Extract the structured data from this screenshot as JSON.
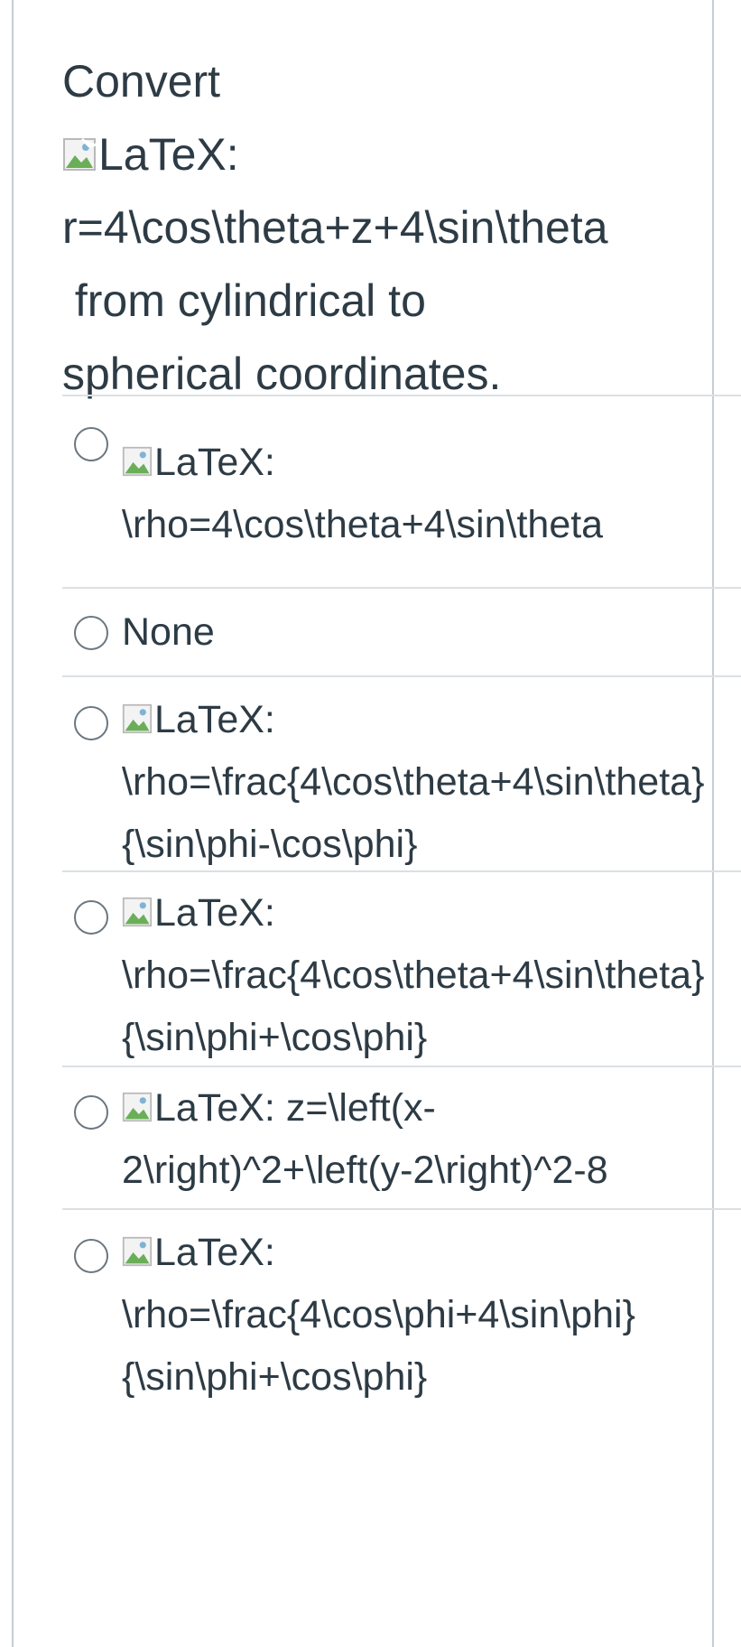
{
  "question": {
    "lines": [
      "Convert",
      "LaTeX:",
      "r=4\\cos\\theta+z+4\\sin\\theta",
      " from cylindrical to",
      "spherical coordinates."
    ]
  },
  "options": [
    {
      "lines": [
        "LaTeX:",
        "\\rho=4\\cos\\theta+4\\sin\\theta"
      ],
      "has_image": true
    },
    {
      "lines": [
        "None"
      ],
      "has_image": false
    },
    {
      "lines": [
        "LaTeX:",
        "\\rho=\\frac{4\\cos\\theta+4\\sin\\theta}",
        "{\\sin\\phi-\\cos\\phi}"
      ],
      "has_image": true
    },
    {
      "lines": [
        "LaTeX:",
        "\\rho=\\frac{4\\cos\\theta+4\\sin\\theta}",
        "{\\sin\\phi+\\cos\\phi}"
      ],
      "has_image": true
    },
    {
      "lines": [
        "LaTeX: z=\\left(x-",
        "2\\right)^2+\\left(y-2\\right)^2-8"
      ],
      "has_image": true
    },
    {
      "lines": [
        "LaTeX:",
        "\\rho=\\frac{4\\cos\\phi+4\\sin\\phi}",
        "{\\sin\\phi+\\cos\\phi}"
      ],
      "has_image": true
    }
  ],
  "icons": {
    "broken_image": "broken-image-icon",
    "radio": "radio-button"
  },
  "colors": {
    "text": "#2d3b45",
    "border": "#c7cdd1",
    "separator": "#dbe0e3",
    "radio_border": "#6b7780"
  }
}
